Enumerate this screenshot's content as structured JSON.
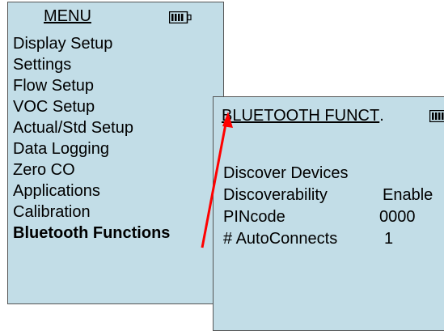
{
  "menu_screen": {
    "title": "MENU",
    "items": [
      {
        "label": "Display Setup"
      },
      {
        "label": "Settings"
      },
      {
        "label": "Flow Setup"
      },
      {
        "label": "VOC Setup"
      },
      {
        "label": "Actual/Std Setup"
      },
      {
        "label": "Data Logging"
      },
      {
        "label": "Zero CO"
      },
      {
        "label": "Applications"
      },
      {
        "label": "Calibration"
      },
      {
        "label": "Bluetooth Functions",
        "selected": true
      }
    ],
    "battery_icon": "battery-icon"
  },
  "bluetooth_screen": {
    "title": "BLUETOOTH FUNCT",
    "title_suffix": ".",
    "battery_icon": "battery-icon",
    "rows": [
      {
        "label": "Discover Devices",
        "value": ""
      },
      {
        "label": "Discoverability",
        "value": "Enable"
      },
      {
        "label": "PINcode",
        "value": "0000"
      },
      {
        "label": "# AutoConnects",
        "value": "1"
      }
    ]
  },
  "colors": {
    "screen_background": "#c2dde7",
    "callout_arrow": "#ff0000"
  }
}
